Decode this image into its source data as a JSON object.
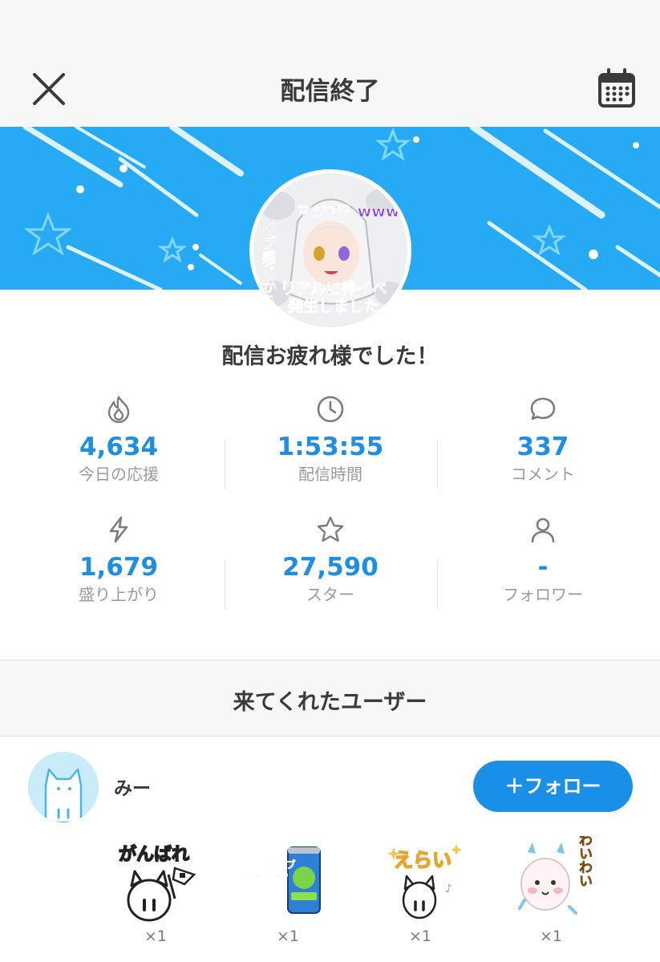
{
  "header": {
    "title": "配信終了",
    "close_icon": "close-icon",
    "calendar_icon": "calendar-icon"
  },
  "banner": {
    "color": "#26aaf3",
    "avatar_texts": {
      "top": "マジで？www",
      "left": "イブ感じから",
      "bottom1": "リアルに神イベ",
      "bottom2": "発生しました"
    }
  },
  "summary": {
    "message": "配信お疲れ様でした！"
  },
  "stats": [
    {
      "icon": "flame-icon",
      "value": "4,634",
      "label": "今日の応援"
    },
    {
      "icon": "clock-icon",
      "value": "1:53:55",
      "label": "配信時間"
    },
    {
      "icon": "comment-icon",
      "value": "337",
      "label": "コメント"
    },
    {
      "icon": "lightning-icon",
      "value": "1,679",
      "label": "盛り上がり"
    },
    {
      "icon": "star-icon",
      "value": "27,590",
      "label": "スター"
    },
    {
      "icon": "person-icon",
      "value": "-",
      "label": "フォロワー"
    }
  ],
  "visitors": {
    "title": "来てくれたユーザー",
    "users": [
      {
        "name": "みー",
        "follow_label": "＋フォロー",
        "gifts": [
          {
            "icon": "ganbare-sticker-icon",
            "text": "がんばれ",
            "count": "×1"
          },
          {
            "icon": "energy-drink-sticker-icon",
            "text1": "ポジティブ",
            "text2": "足りてる？",
            "count": "×1"
          },
          {
            "icon": "erai-sticker-icon",
            "text": "えらい",
            "count": "×1"
          },
          {
            "icon": "waiwai-sticker-icon",
            "text": "わいわい",
            "count": "×1"
          }
        ]
      }
    ]
  },
  "colors": {
    "accent": "#1a8fe8",
    "stat_value": "#1d8ee2",
    "banner": "#26aaf3"
  }
}
